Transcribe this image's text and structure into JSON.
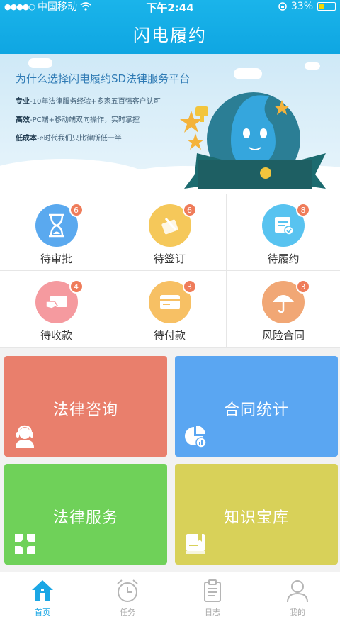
{
  "status_bar": {
    "carrier": "中国移动",
    "time": "下午2:44",
    "battery": "33%"
  },
  "nav": {
    "title": "闪电履约"
  },
  "banner": {
    "headline": "为什么选择闪电履约SD法律服务平台",
    "lines": [
      {
        "key": "专业",
        "text": "-10年法律服务经验+多家五百强客户认可"
      },
      {
        "key": "高效",
        "text": "-PC端+移动端双向操作，实时掌控"
      },
      {
        "key": "低成本",
        "text": "-e时代我们只比律所低一半"
      }
    ]
  },
  "pending": [
    {
      "label": "待审批",
      "count": "6",
      "color": "#5aa9ef",
      "icon": "hourglass-icon"
    },
    {
      "label": "待签订",
      "count": "6",
      "color": "#f5c85a",
      "icon": "sign-pen-icon"
    },
    {
      "label": "待履约",
      "count": "8",
      "color": "#58c3f0",
      "icon": "contract-check-icon"
    },
    {
      "label": "待收款",
      "count": "4",
      "color": "#f59a9f",
      "icon": "receive-card-icon"
    },
    {
      "label": "待付款",
      "count": "3",
      "color": "#f7c064",
      "icon": "credit-card-icon"
    },
    {
      "label": "风险合同",
      "count": "3",
      "color": "#f1a775",
      "icon": "umbrella-icon"
    }
  ],
  "tiles": [
    {
      "label": "法律咨询",
      "color": "#e97f6c",
      "icon": "headset-user-icon"
    },
    {
      "label": "合同统计",
      "color": "#5aa6f2",
      "icon": "pie-chart-icon"
    },
    {
      "label": "法律服务",
      "color": "#6fd159",
      "icon": "clover-icon"
    },
    {
      "label": "知识宝库",
      "color": "#d8d159",
      "icon": "book-icon"
    }
  ],
  "tabs": [
    {
      "label": "首页",
      "icon": "home-icon",
      "active": true
    },
    {
      "label": "任务",
      "icon": "alarm-clock-icon",
      "active": false
    },
    {
      "label": "日志",
      "icon": "clipboard-icon",
      "active": false
    },
    {
      "label": "我的",
      "icon": "user-icon",
      "active": false
    }
  ]
}
